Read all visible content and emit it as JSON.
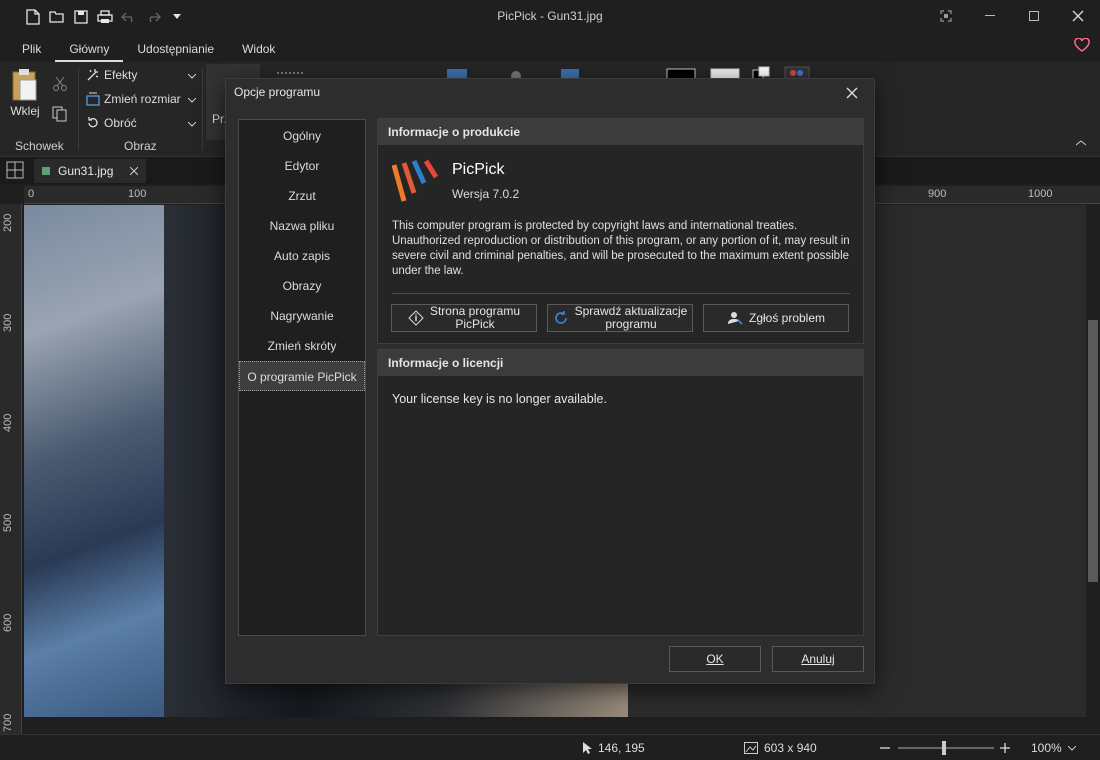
{
  "window": {
    "title": "PicPick - Gun31.jpg"
  },
  "ribbon": {
    "tabs": [
      "Plik",
      "Główny",
      "Udostępnianie",
      "Widok"
    ],
    "paste_label": "Wklej",
    "clipboard_group": "Schowek",
    "image_group": "Obraz",
    "effects_label": "Efekty",
    "resize_label": "Zmień rozmiar",
    "rotate_label": "Obróć",
    "partial_label": "Prz"
  },
  "document": {
    "tab_name": "Gun31.jpg"
  },
  "ruler": {
    "h_labels": [
      "0",
      "100",
      "900",
      "1000"
    ],
    "v_labels": [
      "200",
      "300",
      "400",
      "500",
      "600",
      "700"
    ]
  },
  "status": {
    "cursor_pos": "146, 195",
    "image_size": "603 x 940",
    "zoom": "100%",
    "zoom_level": 0.48
  },
  "dialog": {
    "title": "Opcje programu",
    "nav": [
      "Ogólny",
      "Edytor",
      "Zrzut",
      "Nazwa pliku",
      "Auto zapis",
      "Obrazy",
      "Nagrywanie",
      "Zmień skróty",
      "O programie PicPick"
    ],
    "active_nav": 8,
    "product": {
      "header": "Informacje o produkcie",
      "name": "PicPick",
      "version": "Wersja 7.0.2",
      "description": "This computer program is protected by copyright laws and international treaties. Unauthorized reproduction or distribution of this program, or any portion of it, may result in severe civil and criminal penalties, and will be prosecuted to the maximum extent possible under the law.",
      "btn_homepage_1": "Strona programu",
      "btn_homepage_2": "PicPick",
      "btn_update_1": "Sprawdź aktualizacje",
      "btn_update_2": "programu",
      "btn_report": "Zgłoś problem"
    },
    "license": {
      "header": "Informacje o licencji",
      "text": "Your license key is no longer available."
    },
    "ok_label": "OK",
    "cancel_label": "Anuluj"
  },
  "colors": {
    "accent": "#ff6b8b",
    "logo_orange": "#f07a2a",
    "logo_blue": "#2f7fd0"
  }
}
